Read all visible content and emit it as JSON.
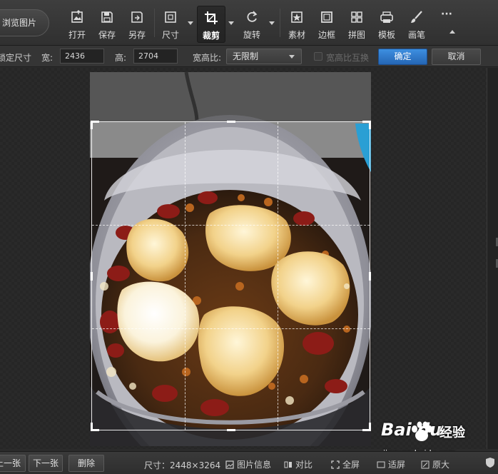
{
  "toolbar": {
    "browse_label": "浏览图片",
    "tools": [
      {
        "label": "打开",
        "icon": "open-icon"
      },
      {
        "label": "保存",
        "icon": "save-icon"
      },
      {
        "label": "另存",
        "icon": "save-as-icon"
      },
      {
        "label": "尺寸",
        "icon": "resize-icon"
      },
      {
        "label": "裁剪",
        "icon": "crop-icon",
        "active": true
      },
      {
        "label": "旋转",
        "icon": "rotate-icon"
      },
      {
        "label": "素材",
        "icon": "material-icon"
      },
      {
        "label": "边框",
        "icon": "border-icon"
      },
      {
        "label": "拼图",
        "icon": "collage-icon"
      },
      {
        "label": "模板",
        "icon": "template-icon"
      },
      {
        "label": "画笔",
        "icon": "brush-icon"
      }
    ],
    "more_label": "···"
  },
  "options": {
    "lock_size_label": "锁定尺寸",
    "width_label": "宽:",
    "width_value": "2436",
    "height_label": "高:",
    "height_value": "2704",
    "ratio_label": "宽高比:",
    "ratio_value": "无限制",
    "swap_label": "宽高比互换",
    "confirm_label": "确定",
    "cancel_label": "取消"
  },
  "statusbar": {
    "prev_label": "上一张",
    "next_label": "下一张",
    "delete_label": "删除",
    "size_text": "尺寸：2448×3264",
    "info_label": "图片信息",
    "compare_label": "对比",
    "fullscreen_label": "全屏",
    "fit_label": "适屏",
    "original_label": "原大"
  },
  "watermark": {
    "logo": "Bai  du",
    "cn": "经验",
    "url": "jingyan.baidu.com"
  },
  "colors": {
    "accent": "#2f7ad0",
    "toolbar_bg": "#363636",
    "canvas_bg": "#2a2a2a"
  }
}
